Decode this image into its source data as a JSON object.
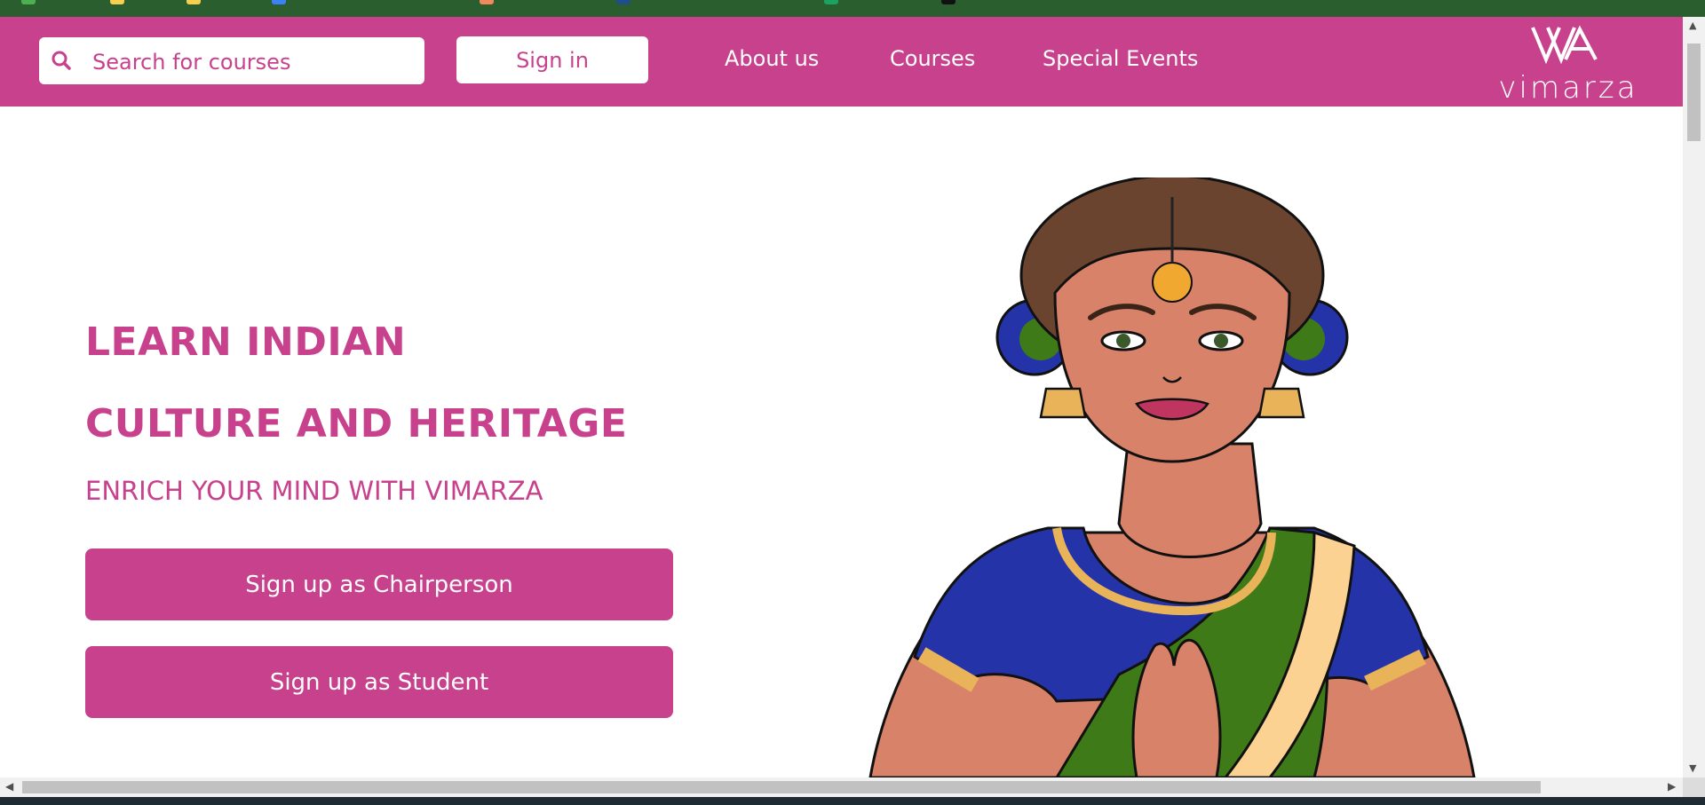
{
  "colors": {
    "brand": "#c8418c",
    "bookmark_bar": "#2a5e2f",
    "white": "#ffffff",
    "saree_blue": "#2434a8",
    "saree_green": "#3f7a18",
    "saree_cream": "#fcd293",
    "skin": "#d9826a",
    "hair": "#6b4430"
  },
  "search": {
    "placeholder": "Search for courses",
    "value": "",
    "icon": "search-icon"
  },
  "header": {
    "signin_label": "Sign in",
    "nav": [
      {
        "label": "About us"
      },
      {
        "label": "Courses"
      },
      {
        "label": "Special Events"
      }
    ],
    "logo_text": "vimarza"
  },
  "hero": {
    "title_line1": "LEARN INDIAN",
    "title_line2": "CULTURE AND HERITAGE",
    "subtitle": "ENRICH YOUR MIND WITH VIMARZA",
    "cta_chairperson": "Sign up as Chairperson",
    "cta_student": "Sign up as Student"
  },
  "illustration": {
    "subject": "woman-namaste-illustration"
  }
}
